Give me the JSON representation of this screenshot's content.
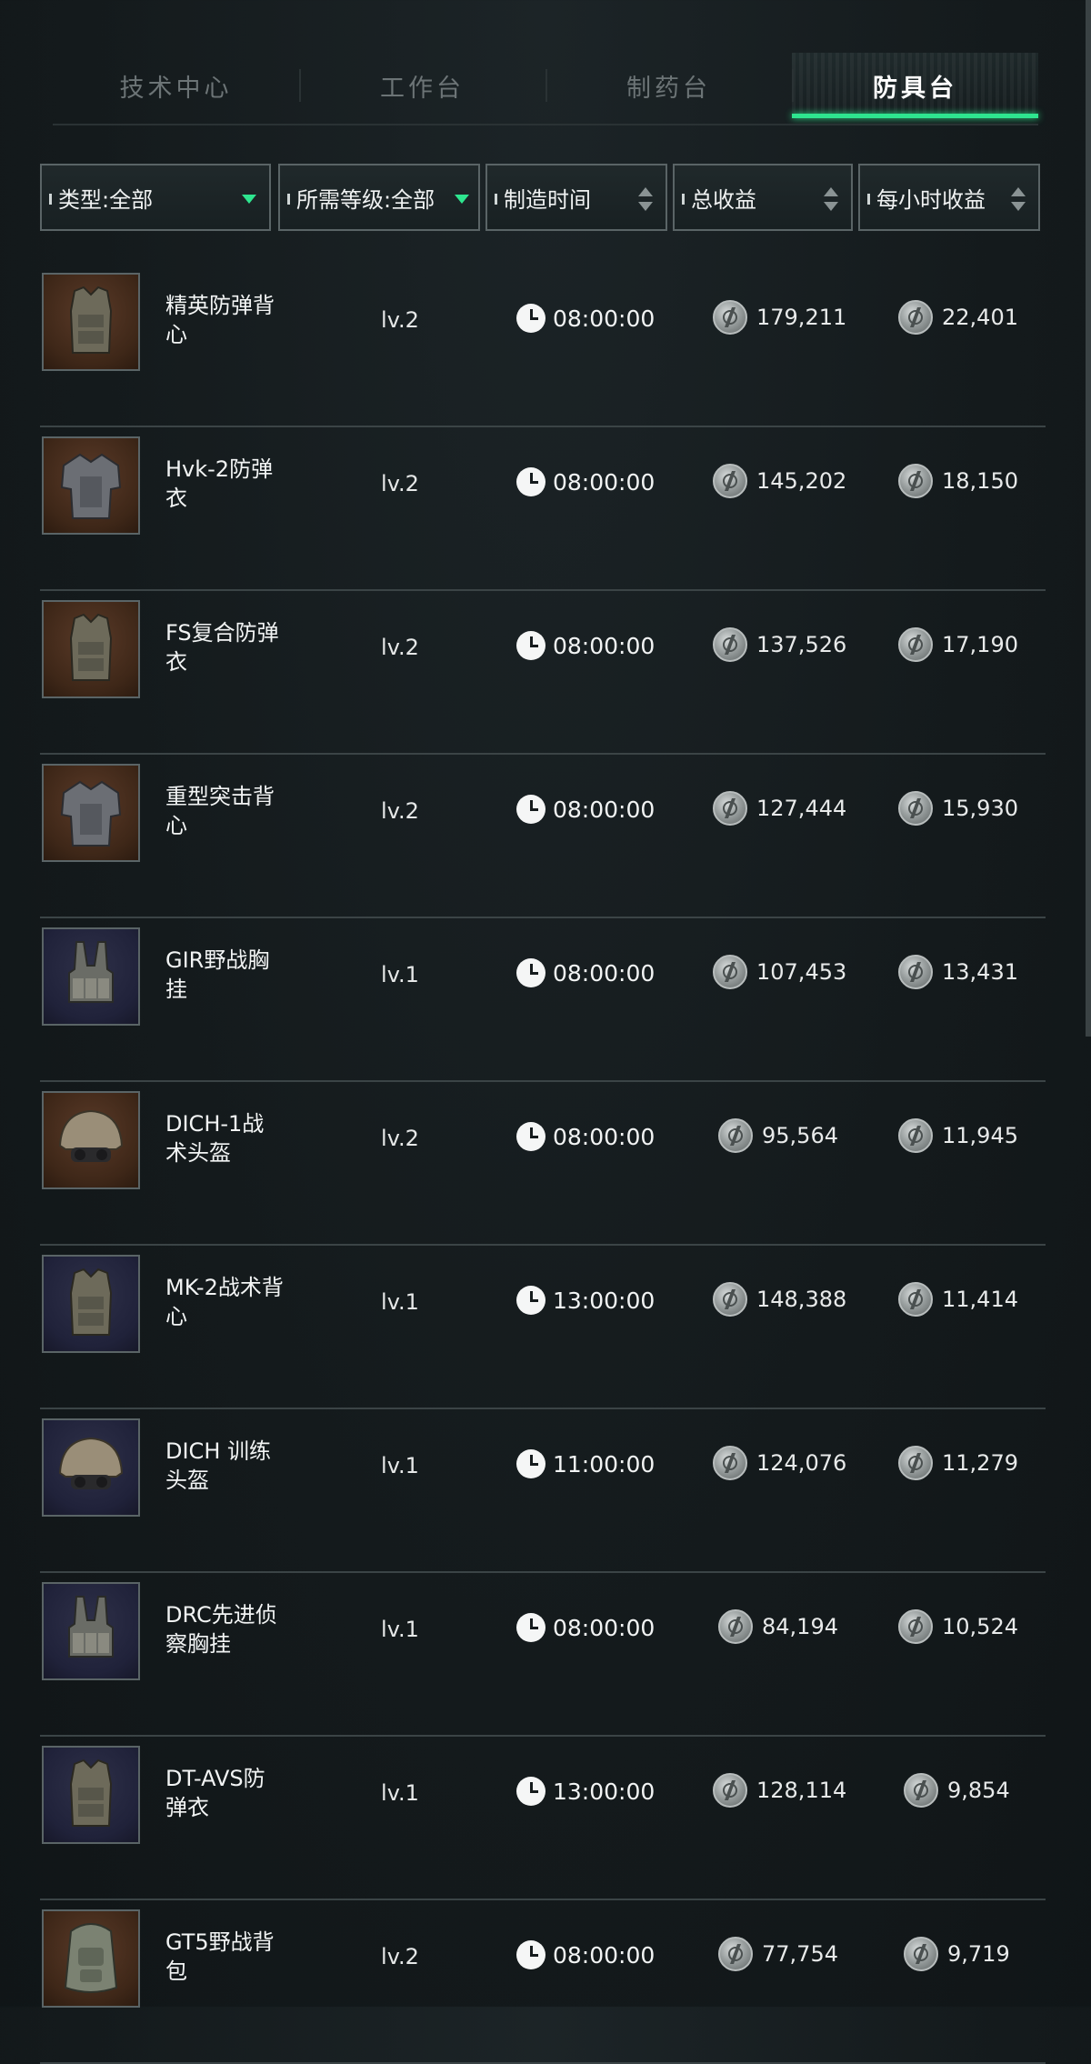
{
  "tabs": [
    {
      "label": "技术中心",
      "active": false
    },
    {
      "label": "工作台",
      "active": false
    },
    {
      "label": "制药台",
      "active": false
    },
    {
      "label": "防具台",
      "active": true
    }
  ],
  "accent_color": "#2ee58f",
  "filters": {
    "type": {
      "label": "类型:全部",
      "icon": "dropdown-triangle"
    },
    "level": {
      "label": "所需等级:全部",
      "icon": "dropdown-triangle"
    },
    "craft_time": {
      "label": "制造时间",
      "icon": "sort-arrows"
    },
    "total_profit": {
      "label": "总收益",
      "icon": "sort-arrows"
    },
    "hourly_profit": {
      "label": "每小时收益",
      "icon": "sort-arrows"
    }
  },
  "items": [
    {
      "name": "精英防弹背心",
      "level": "lv.2",
      "time": "08:00:00",
      "total": "179,211",
      "hourly": "22,401",
      "thumb_bg": "brown",
      "icon": "vest-icon"
    },
    {
      "name": "Hvk-2防弹衣",
      "level": "lv.2",
      "time": "08:00:00",
      "total": "145,202",
      "hourly": "18,150",
      "thumb_bg": "brown",
      "icon": "armor-icon"
    },
    {
      "name": "FS复合防弹衣",
      "level": "lv.2",
      "time": "08:00:00",
      "total": "137,526",
      "hourly": "17,190",
      "thumb_bg": "brown",
      "icon": "vest-icon"
    },
    {
      "name": "重型突击背心",
      "level": "lv.2",
      "time": "08:00:00",
      "total": "127,444",
      "hourly": "15,930",
      "thumb_bg": "brown",
      "icon": "armor-icon"
    },
    {
      "name": "GIR野战胸挂",
      "level": "lv.1",
      "time": "08:00:00",
      "total": "107,453",
      "hourly": "13,431",
      "thumb_bg": "navy",
      "icon": "chest-rig-icon"
    },
    {
      "name": "DICH-1战术头盔",
      "level": "lv.2",
      "time": "08:00:00",
      "total": "95,564",
      "hourly": "11,945",
      "thumb_bg": "brown",
      "icon": "helmet-icon"
    },
    {
      "name": "MK-2战术背心",
      "level": "lv.1",
      "time": "13:00:00",
      "total": "148,388",
      "hourly": "11,414",
      "thumb_bg": "navy",
      "icon": "vest-icon"
    },
    {
      "name": "DICH 训练头盔",
      "level": "lv.1",
      "time": "11:00:00",
      "total": "124,076",
      "hourly": "11,279",
      "thumb_bg": "navy",
      "icon": "helmet-icon"
    },
    {
      "name": "DRC先进侦察胸挂",
      "level": "lv.1",
      "time": "08:00:00",
      "total": "84,194",
      "hourly": "10,524",
      "thumb_bg": "navy",
      "icon": "chest-rig-icon"
    },
    {
      "name": "DT-AVS防弹衣",
      "level": "lv.1",
      "time": "13:00:00",
      "total": "128,114",
      "hourly": "9,854",
      "thumb_bg": "navy",
      "icon": "vest-icon"
    },
    {
      "name": "GT5野战背包",
      "level": "lv.2",
      "time": "08:00:00",
      "total": "77,754",
      "hourly": "9,719",
      "thumb_bg": "brown",
      "icon": "backpack-icon"
    }
  ]
}
